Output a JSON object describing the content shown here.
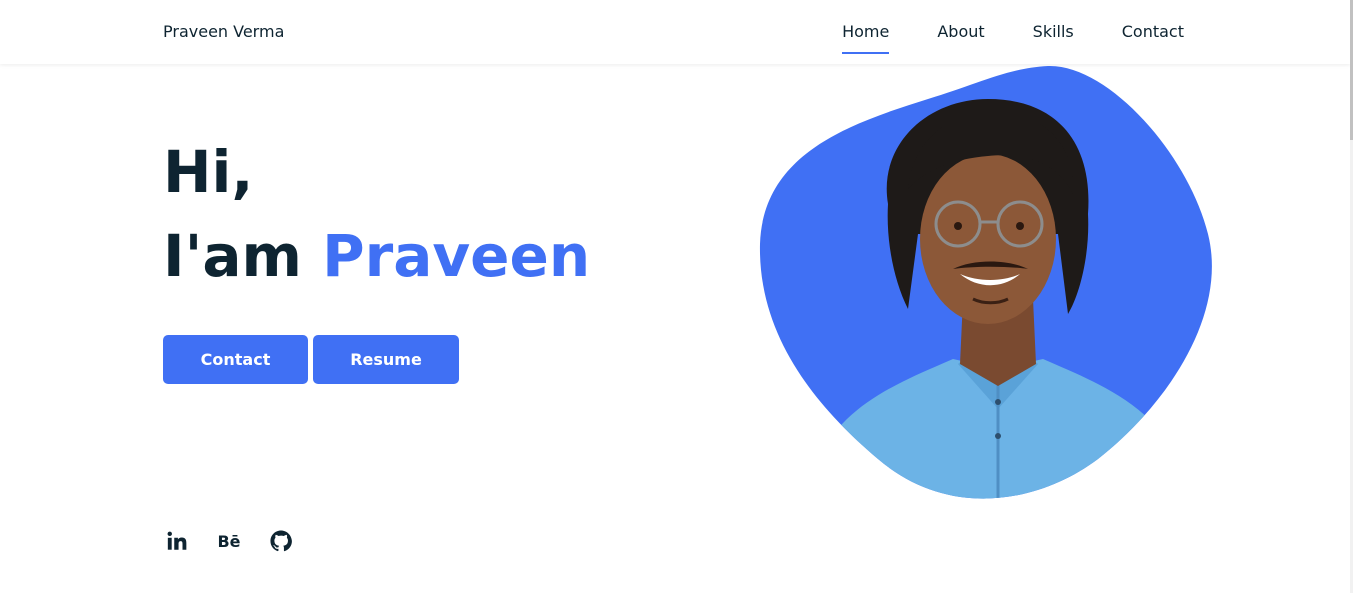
{
  "header": {
    "logo": "Praveen Verma",
    "nav": [
      {
        "label": "Home",
        "active": true
      },
      {
        "label": "About",
        "active": false
      },
      {
        "label": "Skills",
        "active": false
      },
      {
        "label": "Contact",
        "active": false
      }
    ]
  },
  "hero": {
    "greeting": "Hi,",
    "intro": "I'am",
    "name": "Praveen",
    "buttons": {
      "contact": "Contact",
      "resume": "Resume"
    }
  },
  "social": {
    "linkedin_text": "in",
    "behance_text": "Bē",
    "icons": [
      "linkedin-icon",
      "behance-icon",
      "github-icon"
    ]
  },
  "colors": {
    "accent": "#4070f4",
    "text": "#0e2431",
    "background": "#ffffff"
  }
}
